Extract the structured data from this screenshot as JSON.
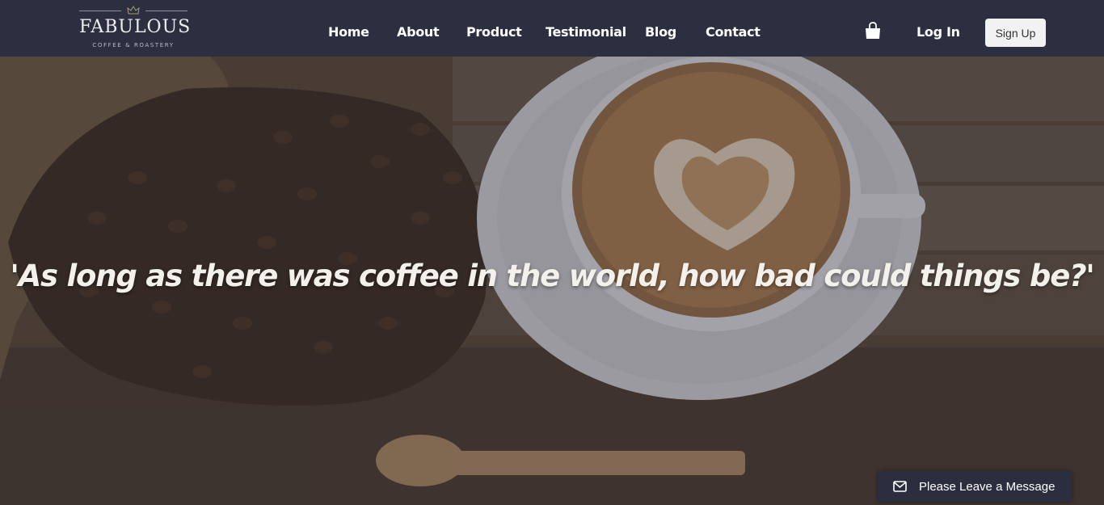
{
  "brand": {
    "name": "FABULOUS",
    "tagline": "COFFEE & ROASTERY"
  },
  "nav": {
    "items": [
      {
        "label": "Home"
      },
      {
        "label": "About"
      },
      {
        "label": "Product"
      },
      {
        "label": "Testimonial"
      },
      {
        "label": "Blog"
      },
      {
        "label": "Contact"
      }
    ],
    "login_label": "Log In",
    "signup_label": "Sign Up",
    "cart_icon": "shopping-bag-icon"
  },
  "hero": {
    "quote": "'As long as there was coffee in the world, how bad could things be?'"
  },
  "widget": {
    "label": "Please Leave a Message",
    "icon": "envelope-icon"
  },
  "colors": {
    "navbar_bg": "#2c2f40",
    "signup_bg": "#f2f2f2",
    "widget_bg": "#2b2e3e"
  }
}
